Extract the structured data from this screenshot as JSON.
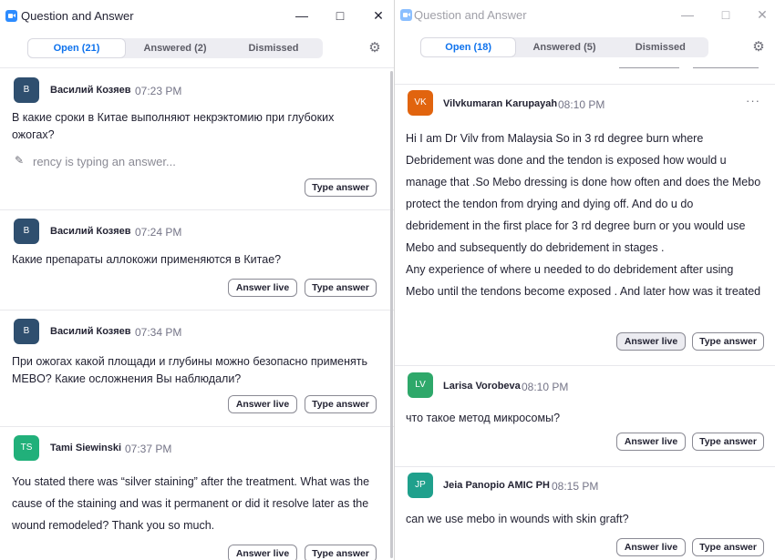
{
  "left": {
    "title": "Question and Answer",
    "tabs": [
      "Open (21)",
      "Answered (2)",
      "Dismissed"
    ],
    "active_tab": 0,
    "typing": "rency is typing an answer...",
    "questions": [
      {
        "initials": "В",
        "name": "Василий Козяев",
        "time": "07:23 PM",
        "text": [
          "В какие сроки в Китае выполняют некрэктомию при глубоких",
          "ожогах?"
        ],
        "answer_live": null,
        "type_answer": "Type answer"
      },
      {
        "initials": "В",
        "name": "Василий Козяев",
        "time": "07:24 PM",
        "text": [
          "Какие препараты аллокожи применяются в Китае?"
        ],
        "answer_live": "Answer live",
        "type_answer": "Type answer"
      },
      {
        "initials": "В",
        "name": "Василий Козяев",
        "time": "07:34 PM",
        "text": [
          "При ожогах какой площади и глубины можно безопасно применять",
          "MEBO? Какие осложнения Вы наблюдали?"
        ],
        "answer_live": "Answer live",
        "type_answer": "Type answer"
      },
      {
        "initials": "TS",
        "name": "Tami Siewinski",
        "time": "07:37 PM",
        "text": [
          "You stated there was “silver staining” after the treatment. What was the",
          "cause of the staining and was it permanent or did it resolve later as the",
          "wound remodeled? Thank you so much."
        ],
        "answer_live": "Answer live",
        "type_answer": "Type answer"
      }
    ]
  },
  "right": {
    "title": "Question and Answer",
    "tabs": [
      "Open (18)",
      "Answered (5)",
      "Dismissed"
    ],
    "active_tab": 0,
    "questions": [
      {
        "initials": "VK",
        "name": "Vilvkumaran Karupayah",
        "time": "08:10 PM",
        "text": [
          "Hi I am Dr Vilv from Malaysia So in 3 rd degree burn where",
          "Debridement was done and the tendon is exposed  how would u",
          "manage that .So Mebo dressing is done how often and does the Mebo",
          "protect the tendon from drying and dying off.  And do u do",
          "debridement in the first place for 3 rd degree burn or you would use",
          "Mebo and subsequently do debridement in stages .",
          "Any experience  of where u needed to do debridement after using",
          "Mebo until the tendons become exposed . And later how was it treated"
        ],
        "answer_live": "Answer live",
        "type_answer": "Type answer",
        "more": "···"
      },
      {
        "initials": "LV",
        "name": "Larisa Vorobeva",
        "time": "08:10 PM",
        "text": [
          "что такое метод  микросомы?"
        ],
        "answer_live": "Answer live",
        "type_answer": "Type answer"
      },
      {
        "initials": "JP",
        "name": "Jeia Panopio AMIC PH",
        "time": "08:15 PM",
        "text": [
          "can we use mebo in wounds with skin graft?"
        ],
        "answer_live": "Answer live",
        "type_answer": "Type answer"
      }
    ]
  },
  "colors": {
    "accent": "#0e72ed",
    "zoom_blue": "#2d8cff",
    "avatar_navy": "#2f4f6f",
    "avatar_teal": "#21b07a",
    "avatar_orange": "#e1640e",
    "avatar_green": "#2ea86a",
    "avatar_jade": "#1fa08c"
  },
  "icons": {
    "app": "zoom-logo-icon",
    "settings": "gear-icon",
    "edit": "pencil-icon",
    "minimize": "minimize-icon",
    "maximize": "maximize-icon",
    "close": "close-icon"
  }
}
